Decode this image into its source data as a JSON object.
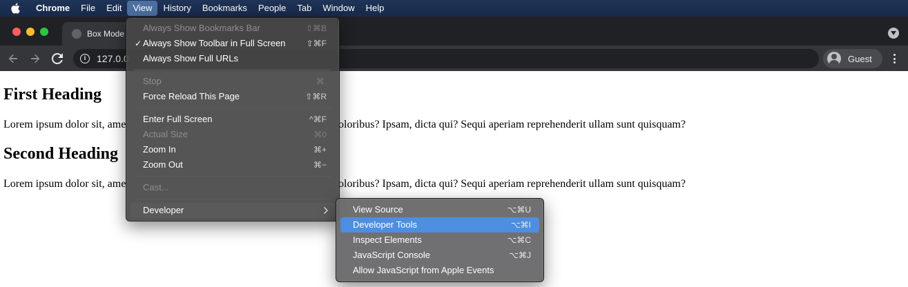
{
  "menubar": {
    "app_name": "Chrome",
    "items": [
      "File",
      "Edit",
      "View",
      "History",
      "Bookmarks",
      "People",
      "Tab",
      "Window",
      "Help"
    ]
  },
  "tab": {
    "title": "Box Mode"
  },
  "omnibox": {
    "url": "127.0.0"
  },
  "profile": {
    "label": "Guest"
  },
  "page": {
    "heading1": "First Heading",
    "para1_left": "Lorem ipsum dolor sit, ame",
    "para1_right": "oloribus? Ipsam, dicta qui? Sequi aperiam reprehenderit ullam sunt quisquam?",
    "heading2": "Second Heading",
    "para2_left": "Lorem ipsum dolor sit, ame",
    "para2_right": "oloribus? Ipsam, dicta qui? Sequi aperiam reprehenderit ullam sunt quisquam?"
  },
  "view_menu": {
    "items": [
      {
        "label": "Always Show Bookmarks Bar",
        "shortcut": "⇧⌘B",
        "disabled": true
      },
      {
        "label": "Always Show Toolbar in Full Screen",
        "shortcut": "⇧⌘F",
        "checked": true,
        "check": "✓"
      },
      {
        "label": "Always Show Full URLs",
        "shortcut": ""
      },
      {
        "label": "Stop",
        "shortcut": "⌘.",
        "disabled": true
      },
      {
        "label": "Force Reload This Page",
        "shortcut": "⇧⌘R"
      },
      {
        "label": "Enter Full Screen",
        "shortcut": "^⌘F"
      },
      {
        "label": "Actual Size",
        "shortcut": "⌘0",
        "disabled": true
      },
      {
        "label": "Zoom In",
        "shortcut": "⌘+"
      },
      {
        "label": "Zoom Out",
        "shortcut": "⌘−"
      },
      {
        "label": "Cast...",
        "shortcut": "",
        "disabled": true
      },
      {
        "label": "Developer",
        "shortcut": "",
        "submenu": true
      }
    ]
  },
  "developer_menu": {
    "items": [
      {
        "label": "View Source",
        "shortcut": "⌥⌘U"
      },
      {
        "label": "Developer Tools",
        "shortcut": "⌥⌘I",
        "highlighted": true
      },
      {
        "label": "Inspect Elements",
        "shortcut": "⌥⌘C"
      },
      {
        "label": "JavaScript Console",
        "shortcut": "⌥⌘J"
      },
      {
        "label": "Allow JavaScript from Apple Events",
        "shortcut": ""
      }
    ]
  },
  "colors": {
    "menubar": "#1f3457",
    "menu_highlight": "#4d8ee0",
    "tab_strip": "#202124",
    "toolbar": "#35363a"
  },
  "icons": [
    "apple-icon",
    "back-arrow-icon",
    "forward-arrow-icon",
    "reload-icon",
    "info-icon",
    "guest-avatar-icon",
    "more-vert-icon",
    "tab-search-icon",
    "checkmark-icon",
    "chevron-right-icon"
  ]
}
